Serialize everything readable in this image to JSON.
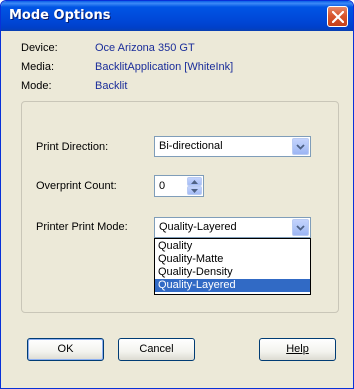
{
  "window": {
    "title": "Mode Options",
    "close_icon": "close-icon",
    "title_bar_color": "#0054e3"
  },
  "info": {
    "device_label": "Device:",
    "device_value": "Oce Arizona 350 GT",
    "media_label": "Media:",
    "media_value": "BacklitApplication [WhiteInk]",
    "mode_label": "Mode:",
    "mode_value": "Backlit",
    "value_color": "#1a2d9a"
  },
  "settings": {
    "print_direction_label": "Print Direction:",
    "print_direction_value": "Bi-directional",
    "overprint_count_label": "Overprint Count:",
    "overprint_count_value": "0",
    "printer_print_mode_label": "Printer Print Mode:",
    "printer_print_mode_value": "Quality-Layered",
    "printer_print_mode_options": [
      "Quality",
      "Quality-Matte",
      "Quality-Density",
      "Quality-Layered"
    ],
    "selected_option": "Quality-Layered",
    "selection_color": "#316ac5"
  },
  "buttons": {
    "ok_label": "OK",
    "cancel_label": "Cancel",
    "help_label": "Help"
  }
}
